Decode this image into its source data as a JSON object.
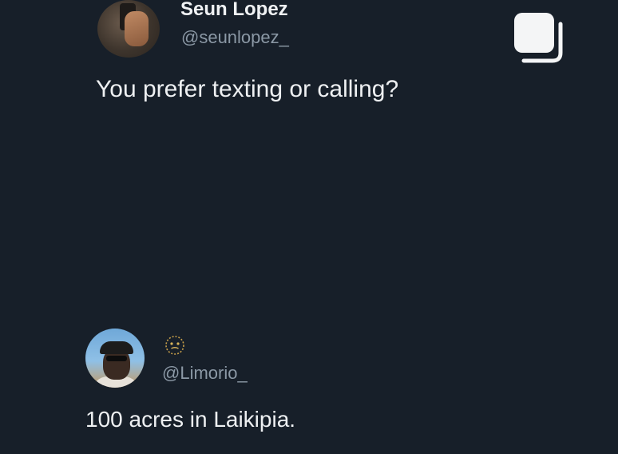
{
  "tweet": {
    "author_name": "Seun Lopez",
    "author_handle": "@seunlopez_",
    "text": "You prefer texting or calling?",
    "avatar_icon": "user-avatar-photo",
    "action_icon": "copy-icon"
  },
  "reply": {
    "author_handle": "@Limorio_",
    "text": "100 acres in Laikipia.",
    "avatar_icon": "user-avatar-photo",
    "name_icon": "smiley-face-icon"
  },
  "colors": {
    "background": "#171f29",
    "primary_text": "#eef0f2",
    "secondary_text": "#8b98a5"
  }
}
